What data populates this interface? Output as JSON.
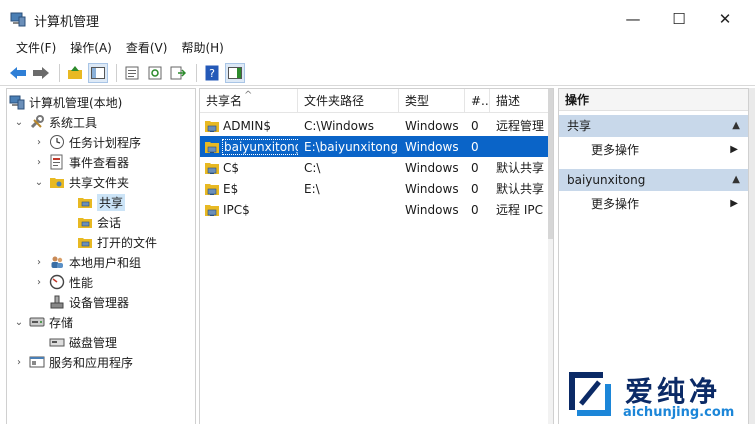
{
  "window": {
    "title": "计算机管理",
    "controls": {
      "minimize": "—",
      "maximize": "☐",
      "close": "✕"
    }
  },
  "menu": [
    "文件(F)",
    "操作(A)",
    "查看(V)",
    "帮助(H)"
  ],
  "tree": [
    {
      "label": "计算机管理(本地)",
      "arrow": "",
      "icon": "computer-management-icon",
      "level": 0
    },
    {
      "label": "系统工具",
      "arrow": "⌄",
      "icon": "tools-icon",
      "level": 1
    },
    {
      "label": "任务计划程序",
      "arrow": "›",
      "icon": "clock-icon",
      "level": 2
    },
    {
      "label": "事件查看器",
      "arrow": "›",
      "icon": "event-viewer-icon",
      "level": 2
    },
    {
      "label": "共享文件夹",
      "arrow": "⌄",
      "icon": "shared-folder-icon",
      "level": 2
    },
    {
      "label": "共享",
      "arrow": "",
      "icon": "share-icon",
      "level": 3,
      "selected": true
    },
    {
      "label": "会话",
      "arrow": "",
      "icon": "share-icon",
      "level": 3
    },
    {
      "label": "打开的文件",
      "arrow": "",
      "icon": "share-icon",
      "level": 3
    },
    {
      "label": "本地用户和组",
      "arrow": "›",
      "icon": "users-icon",
      "level": 2
    },
    {
      "label": "性能",
      "arrow": "›",
      "icon": "performance-icon",
      "level": 2
    },
    {
      "label": "设备管理器",
      "arrow": "",
      "icon": "device-manager-icon",
      "level": 2
    },
    {
      "label": "存储",
      "arrow": "⌄",
      "icon": "storage-icon",
      "level": 1
    },
    {
      "label": "磁盘管理",
      "arrow": "",
      "icon": "disk-icon",
      "level": 2
    },
    {
      "label": "服务和应用程序",
      "arrow": "›",
      "icon": "services-icon",
      "level": 1
    }
  ],
  "list": {
    "sort_indicator": "^",
    "columns": [
      "共享名",
      "文件夹路径",
      "类型",
      "#..",
      "描述"
    ],
    "rows": [
      {
        "name": "ADMIN$",
        "path": "C:\\Windows",
        "type": "Windows",
        "count": "0",
        "desc": "远程管理"
      },
      {
        "name": "baiyunxitong",
        "path": "E:\\baiyunxitong",
        "type": "Windows",
        "count": "0",
        "desc": "",
        "selected": true
      },
      {
        "name": "C$",
        "path": "C:\\",
        "type": "Windows",
        "count": "0",
        "desc": "默认共享"
      },
      {
        "name": "E$",
        "path": "E:\\",
        "type": "Windows",
        "count": "0",
        "desc": "默认共享"
      },
      {
        "name": "IPC$",
        "path": "",
        "type": "Windows",
        "count": "0",
        "desc": "远程 IPC"
      }
    ]
  },
  "actions": {
    "title": "操作",
    "groups": [
      {
        "label": "共享",
        "more": "更多操作"
      },
      {
        "label": "baiyunxitong",
        "more": "更多操作"
      }
    ]
  },
  "watermark": {
    "text": "爱纯净",
    "url": "aichunjing.com"
  },
  "colors": {
    "selection": "#0a64c8",
    "tree_selection": "#cce4f7",
    "action_header": "#c8d8ea"
  }
}
